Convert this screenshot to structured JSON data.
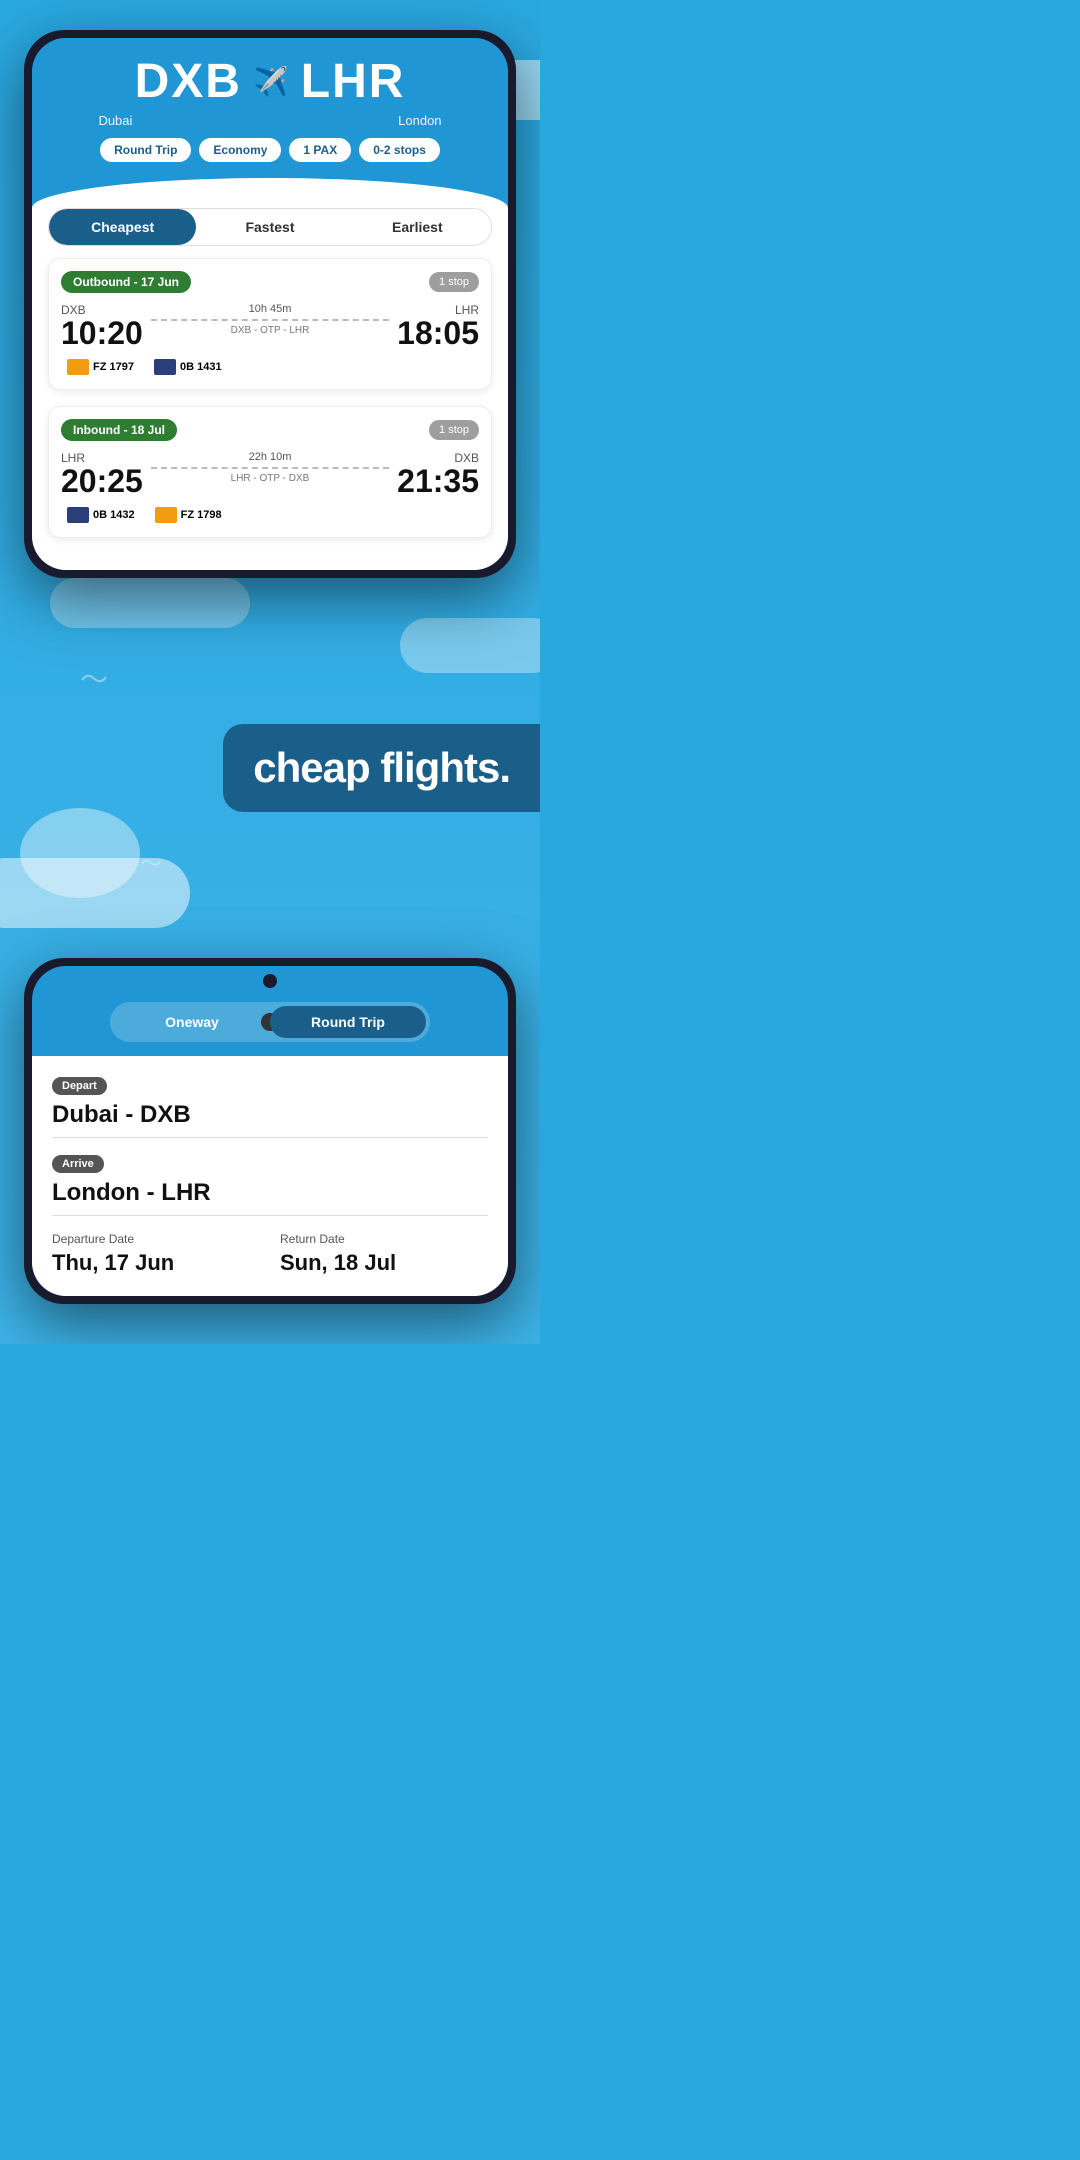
{
  "phone1": {
    "header": {
      "origin_code": "DXB",
      "origin_city": "Dubai",
      "destination_code": "LHR",
      "destination_city": "London",
      "plane_icon": "✈",
      "tags": [
        "Round Trip",
        "Economy",
        "1 PAX",
        "0-2 stops"
      ]
    },
    "tabs": [
      {
        "label": "Cheapest",
        "active": true
      },
      {
        "label": "Fastest",
        "active": false
      },
      {
        "label": "Earliest",
        "active": false
      }
    ],
    "outbound": {
      "label": "Outbound - 17 Jun",
      "stops": "1 stop",
      "origin": "DXB",
      "destination": "LHR",
      "depart_time": "10:20",
      "arrive_time": "18:05",
      "duration": "10h 45m",
      "route": "DXB - OTP - LHR",
      "airlines": [
        {
          "code": "FZ 1797",
          "type": "flydubai"
        },
        {
          "code": "0B 1431",
          "type": "tarom"
        }
      ]
    },
    "inbound": {
      "label": "Inbound - 18 Jul",
      "stops": "1 stop",
      "origin": "LHR",
      "destination": "DXB",
      "depart_time": "20:25",
      "arrive_time": "21:35",
      "duration": "22h 10m",
      "route": "LHR - OTP - DXB",
      "airlines": [
        {
          "code": "0B 1432",
          "type": "tarom"
        },
        {
          "code": "FZ 1798",
          "type": "flydubai"
        }
      ]
    }
  },
  "middle": {
    "tagline": "cheap flights."
  },
  "phone2": {
    "toggle": {
      "option1": "Oneway",
      "option2": "Round Trip",
      "active": "Round Trip"
    },
    "depart_label": "Depart",
    "depart_value": "Dubai - DXB",
    "arrive_label": "Arrive",
    "arrive_value": "London - LHR",
    "departure_date_label": "Departure Date",
    "departure_date_value": "Thu, 17 Jun",
    "return_date_label": "Return Date",
    "return_date_value": "Sun, 18 Jul"
  }
}
